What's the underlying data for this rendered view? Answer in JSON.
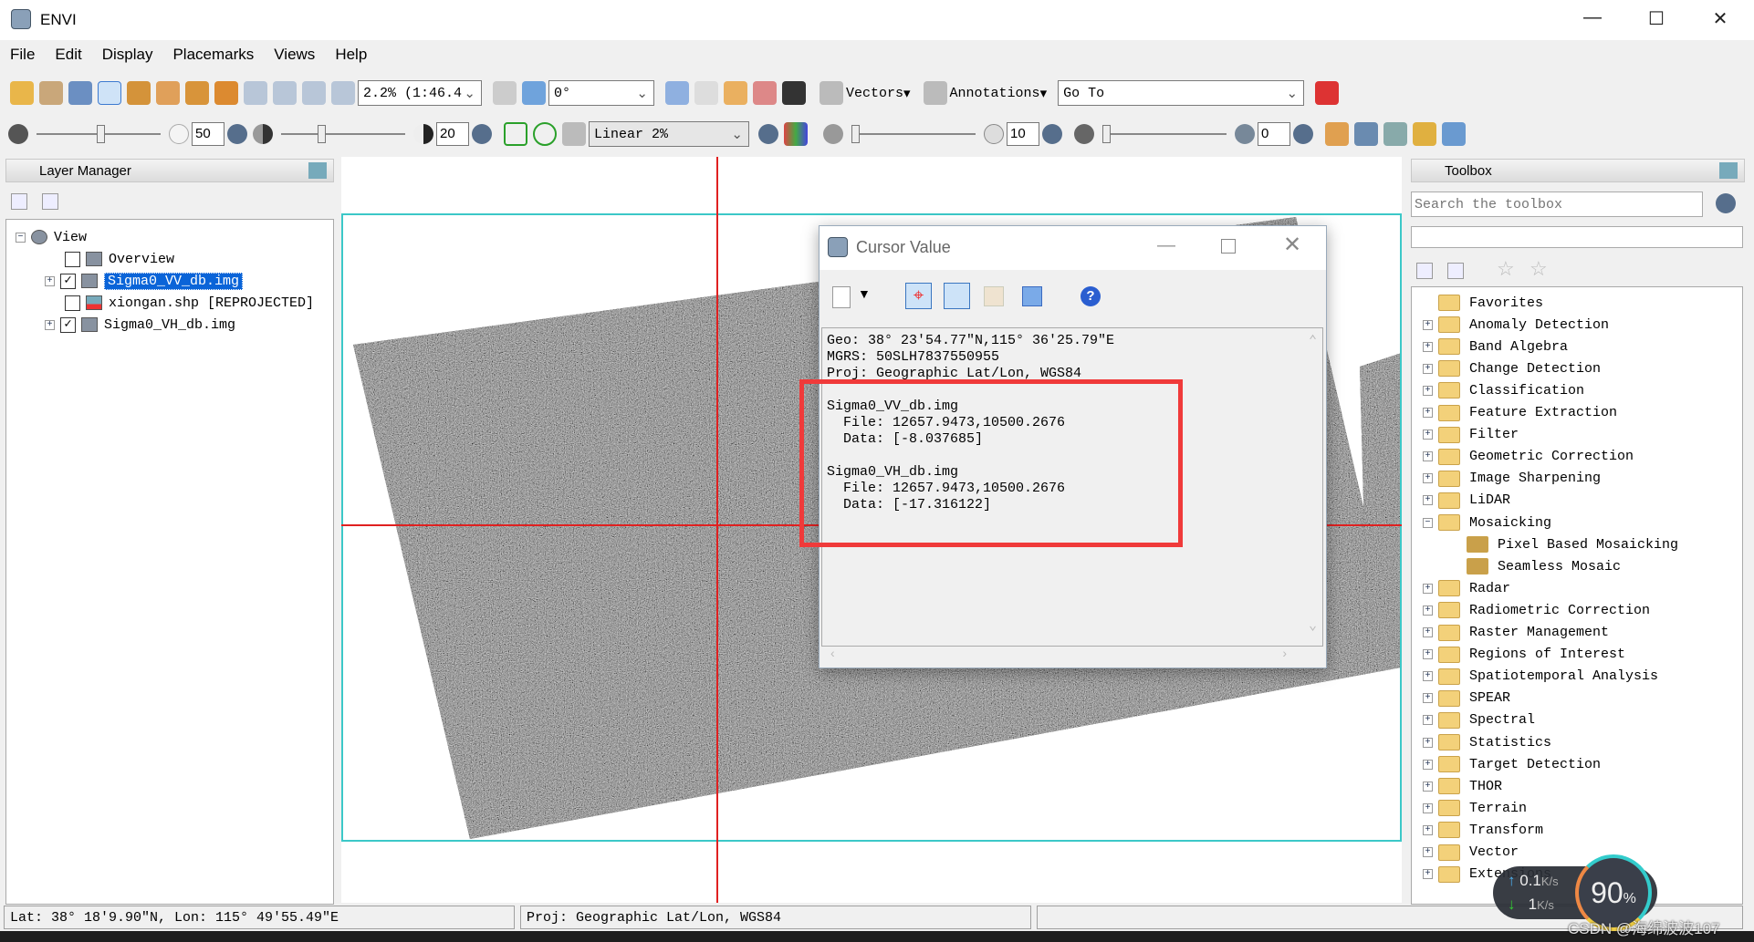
{
  "window": {
    "title": "ENVI",
    "controls": [
      "—",
      "☐",
      "✕"
    ]
  },
  "menu": [
    "File",
    "Edit",
    "Display",
    "Placemarks",
    "Views",
    "Help"
  ],
  "toolbar1": {
    "zoom_value": "2.2% (1:46.4",
    "rotation_value": "0°",
    "vectors_label": "Vectors",
    "annotations_label": "Annotations",
    "goto_value": "Go To"
  },
  "toolbar2": {
    "brightness": "50",
    "contrast": "20",
    "stretch": "Linear 2%",
    "sharpen": "10",
    "transparency": "0"
  },
  "layer_manager": {
    "title": "Layer Manager",
    "root": "View",
    "layers": [
      {
        "name": "Overview",
        "checked": false,
        "expandable": false
      },
      {
        "name": "Sigma0_VV_db.img",
        "checked": true,
        "expandable": true,
        "selected": true
      },
      {
        "name": "xiongan.shp [REPROJECTED]",
        "checked": false,
        "expandable": false
      },
      {
        "name": "Sigma0_VH_db.img",
        "checked": true,
        "expandable": true
      }
    ]
  },
  "cursor_value": {
    "title": "Cursor Value",
    "lines": [
      "Geo: 38° 23′54.77″N,115° 36′25.79″E",
      "MGRS: 50SLH7837550955",
      "Proj: Geographic Lat/Lon, WGS84",
      "",
      "Sigma0_VV_db.img",
      "  File: 12657.9473,10500.2676",
      "  Data: [-8.037685]",
      "",
      "Sigma0_VH_db.img",
      "  File: 12657.9473,10500.2676",
      "  Data: [-17.316122]"
    ],
    "highlight_color": "#f03a3a"
  },
  "toolbox": {
    "title": "Toolbox",
    "search_placeholder": "Search the toolbox",
    "items": [
      {
        "label": "Favorites",
        "level": 0
      },
      {
        "label": "Anomaly Detection",
        "level": 0
      },
      {
        "label": "Band Algebra",
        "level": 0
      },
      {
        "label": "Change Detection",
        "level": 0
      },
      {
        "label": "Classification",
        "level": 0
      },
      {
        "label": "Feature Extraction",
        "level": 0
      },
      {
        "label": "Filter",
        "level": 0
      },
      {
        "label": "Geometric Correction",
        "level": 0
      },
      {
        "label": "Image Sharpening",
        "level": 0
      },
      {
        "label": "LiDAR",
        "level": 0
      },
      {
        "label": "Mosaicking",
        "level": 0,
        "expanded": true
      },
      {
        "label": "Pixel Based Mosaicking",
        "level": 1
      },
      {
        "label": "Seamless Mosaic",
        "level": 1
      },
      {
        "label": "Radar",
        "level": 0
      },
      {
        "label": "Radiometric Correction",
        "level": 0
      },
      {
        "label": "Raster Management",
        "level": 0
      },
      {
        "label": "Regions of Interest",
        "level": 0
      },
      {
        "label": "Spatiotemporal Analysis",
        "level": 0
      },
      {
        "label": "SPEAR",
        "level": 0
      },
      {
        "label": "Spectral",
        "level": 0
      },
      {
        "label": "Statistics",
        "level": 0
      },
      {
        "label": "Target Detection",
        "level": 0
      },
      {
        "label": "THOR",
        "level": 0
      },
      {
        "label": "Terrain",
        "level": 0
      },
      {
        "label": "Transform",
        "level": 0
      },
      {
        "label": "Vector",
        "level": 0
      },
      {
        "label": "Extensions",
        "level": 0
      }
    ]
  },
  "status": {
    "latlon": "Lat: 38° 18′9.90″N, Lon: 115° 49′55.49″E",
    "proj": "Proj: Geographic Lat/Lon, WGS84"
  },
  "net_widget": {
    "up": "0.1",
    "down": "1",
    "unit": "K/s",
    "percent": "90",
    "percent_sign": "%"
  },
  "watermark": "CSDN @海绵波波107",
  "colors": {
    "crosshair": "#e02020",
    "frame": "#3cc8c8",
    "selection": "#0a64d8"
  }
}
